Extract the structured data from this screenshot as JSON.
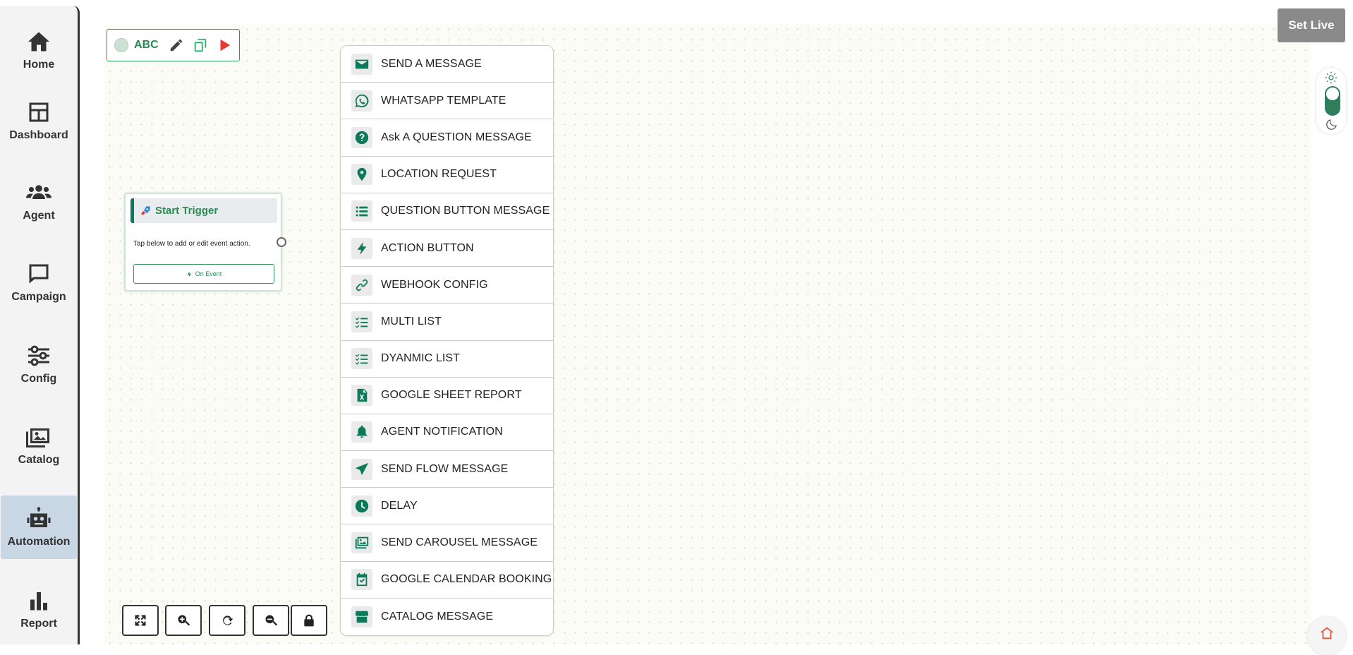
{
  "sidebar": {
    "items": [
      {
        "label": "Home",
        "icon": "home-icon"
      },
      {
        "label": "Dashboard",
        "icon": "dashboard-icon"
      },
      {
        "label": "Agent",
        "icon": "users-icon"
      },
      {
        "label": "Campaign",
        "icon": "chat-bubble-icon"
      },
      {
        "label": "Config",
        "icon": "sliders-icon"
      },
      {
        "label": "Catalog",
        "icon": "image-gallery-icon"
      },
      {
        "label": "Automation",
        "icon": "robot-icon",
        "active": true
      },
      {
        "label": "Report",
        "icon": "bar-chart-icon"
      }
    ]
  },
  "flow": {
    "name": "ABC"
  },
  "trigger": {
    "title": "Start Trigger",
    "description": "Tap below to add or edit event action.",
    "button_label": "On Event"
  },
  "menu": {
    "items": [
      {
        "label": "SEND A MESSAGE",
        "icon": "envelope-icon"
      },
      {
        "label": "WHATSAPP TEMPLATE",
        "icon": "whatsapp-icon"
      },
      {
        "label": "Ask A QUESTION MESSAGE",
        "icon": "question-circle-icon"
      },
      {
        "label": "LOCATION REQUEST",
        "icon": "location-pin-icon"
      },
      {
        "label": "QUESTION BUTTON MESSAGE",
        "icon": "list-icon"
      },
      {
        "label": "ACTION BUTTON",
        "icon": "lightning-icon"
      },
      {
        "label": "WEBHOOK CONFIG",
        "icon": "link-icon"
      },
      {
        "label": "MULTI LIST",
        "icon": "checklist-icon"
      },
      {
        "label": "DYANMIC LIST",
        "icon": "checklist-icon"
      },
      {
        "label": "GOOGLE SHEET REPORT",
        "icon": "excel-file-icon"
      },
      {
        "label": "AGENT NOTIFICATION",
        "icon": "bell-icon"
      },
      {
        "label": "SEND FLOW MESSAGE",
        "icon": "paper-plane-icon"
      },
      {
        "label": "DELAY",
        "icon": "clock-icon"
      },
      {
        "label": "SEND CAROUSEL MESSAGE",
        "icon": "images-icon"
      },
      {
        "label": "GOOGLE CALENDAR BOOKING",
        "icon": "calendar-check-icon"
      },
      {
        "label": "CATALOG MESSAGE",
        "icon": "store-icon"
      }
    ]
  },
  "header": {
    "set_live_label": "Set Live"
  },
  "colors": {
    "accent": "#0a7a5a",
    "flow_text": "#2b8a54",
    "set_live_bg": "#8a8a8a",
    "active_nav_bg": "#c9d6e3"
  }
}
